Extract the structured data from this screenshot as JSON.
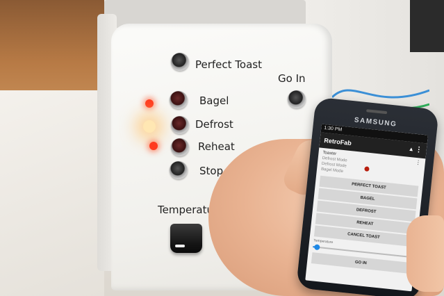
{
  "toaster": {
    "buttons": [
      {
        "label": "Perfect Toast"
      },
      {
        "label": "Bagel"
      },
      {
        "label": "Defrost"
      },
      {
        "label": "Reheat"
      },
      {
        "label": "Stop"
      }
    ],
    "go_in_label": "Go In",
    "temperature_label": "Temperature"
  },
  "phone": {
    "brand": "SAMSUNG",
    "status_time": "1:30 PM",
    "app_title": "RetroFab",
    "device_name": "Toaster",
    "modes": [
      "Defrost Mode",
      "Defrost Mode",
      "Bagel Mode"
    ],
    "buttons": {
      "perfect_toast": "PERFECT TOAST",
      "bagel": "BAGEL",
      "defrost": "DEFROST",
      "reheat": "REHEAT",
      "cancel_toast": "CANCEL TOAST",
      "go_in": "GO IN"
    },
    "temperature_label": "Temperature",
    "temperature_level": 0.03,
    "accent_color": "#1e88e5",
    "indicator_color": "#b81e0e",
    "icons": [
      "menu-icon",
      "up-arrow-icon"
    ]
  }
}
